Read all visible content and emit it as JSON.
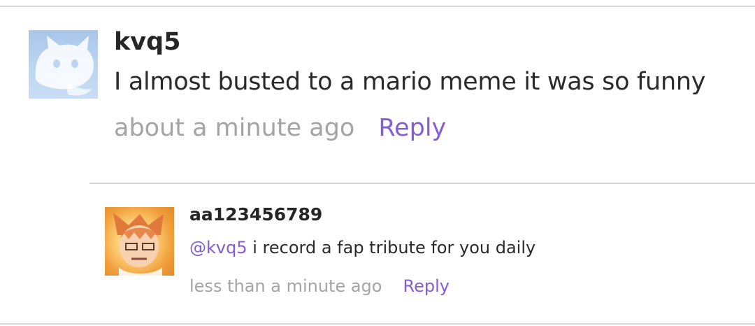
{
  "comment": {
    "username": "kvq5",
    "text": "I almost busted to a mario meme it was so funny",
    "timestamp": "about a minute ago",
    "reply_label": "Reply",
    "avatar_icon": "cat-avatar-icon"
  },
  "reply": {
    "username": "aa123456789",
    "mention": "@kvq5",
    "text": " i record a fap tribute for you daily",
    "timestamp": "less than a minute ago",
    "reply_label": "Reply",
    "avatar_icon": "anime-character-avatar"
  },
  "colors": {
    "accent": "#855cd6",
    "muted": "#a4a4a4",
    "text": "#262626",
    "divider": "#d8d8d8"
  }
}
